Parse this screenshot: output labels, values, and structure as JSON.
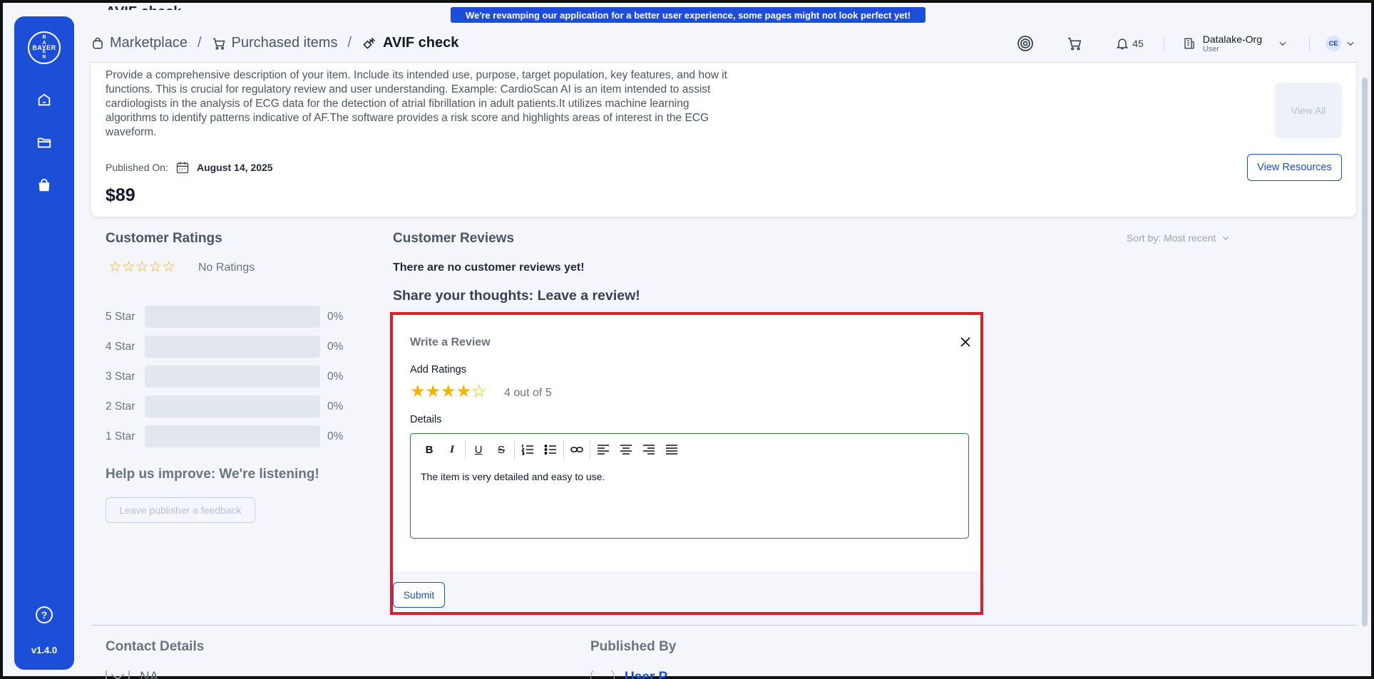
{
  "banner": "We're revamping our application for a better user experience, some pages might not look perfect yet!",
  "sidebar": {
    "logo_text": "BAYER",
    "version": "v1.4.0"
  },
  "breadcrumb": {
    "marketplace": "Marketplace",
    "purchased": "Purchased items",
    "current": "AVIF check"
  },
  "header": {
    "notifications": "45",
    "org_name": "Datalake-Org",
    "org_role": "User",
    "avatar": "CE"
  },
  "previous_title": "AVIF check",
  "item": {
    "description": "Provide a comprehensive description of your item. Include its intended use, purpose, target population, key features, and how it functions. This is crucial for regulatory review and user understanding. Example: CardioScan AI is an item intended to assist cardiologists in the analysis of ECG data for the detection of atrial fibrillation in adult patients.It utilizes machine learning algorithms to identify patterns indicative of AF.The software provides a risk score and highlights areas of interest in the ECG waveform.",
    "view_all": "View All",
    "published_label": "Published On:",
    "published_date": "August 14, 2025",
    "price": "$89",
    "view_resources": "View Resources"
  },
  "ratings": {
    "title": "Customer Ratings",
    "stars": "☆☆☆☆☆",
    "no_ratings": "No Ratings",
    "rows": [
      {
        "label": "5 Star",
        "pct": "0%",
        "fill": 0
      },
      {
        "label": "4 Star",
        "pct": "0%",
        "fill": 0
      },
      {
        "label": "3 Star",
        "pct": "0%",
        "fill": 0
      },
      {
        "label": "2 Star",
        "pct": "0%",
        "fill": 0
      },
      {
        "label": "1 Star",
        "pct": "0%",
        "fill": 0
      }
    ],
    "help_title": "Help us improve: We're listening!",
    "feedback_button": "Leave publisher a feedback"
  },
  "reviews": {
    "title": "Customer Reviews",
    "sort": "Sort by: Most recent",
    "empty": "There are no customer reviews yet!",
    "share_title": "Share your thoughts: Leave a review!"
  },
  "review_form": {
    "title": "Write a Review",
    "add_ratings_label": "Add Ratings",
    "rating_value": 4,
    "rating_max": 5,
    "rating_text": "4 out of 5",
    "details_label": "Details",
    "details_text": "The item is very detailed and easy to use.",
    "submit": "Submit",
    "accent_border": "#e11d2a",
    "editor_border": "#2e7d32"
  },
  "footer": {
    "contact_title": "Contact Details",
    "contact_value": "NA",
    "published_by_title": "Published By",
    "published_by_value": "User P"
  },
  "colors": {
    "brand": "#1d4ed8",
    "star": "#f5b301",
    "background": "#f4f6fb"
  }
}
